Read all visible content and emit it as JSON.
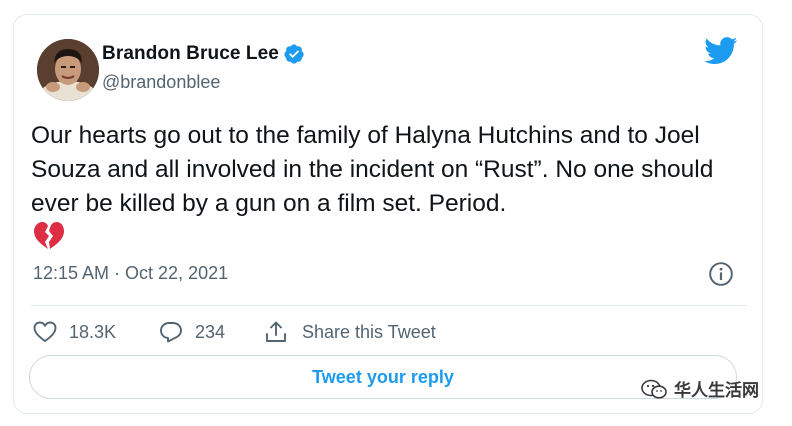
{
  "tweet": {
    "author": {
      "display_name": "Brandon Bruce Lee",
      "handle": "@brandonblee",
      "verified": true
    },
    "text": "Our hearts go out to the family of Halyna Hutchins and to Joel Souza and all involved in the incident on “Rust”. No one should ever be killed by a gun on a film set. Period.",
    "emoji": "broken-heart",
    "timestamp": "12:15 AM · Oct 22, 2021",
    "likes": "18.3K",
    "replies": "234",
    "share_label": "Share this Tweet",
    "reply_button_label": "Tweet your reply"
  },
  "watermark": {
    "text": "华人生活网"
  },
  "icons": {
    "brand": "twitter-bird-icon",
    "verified": "verified-badge-icon",
    "info": "info-icon",
    "like": "heart-outline-icon",
    "reply": "speech-bubble-icon",
    "share": "share-upload-icon"
  },
  "colors": {
    "accent": "#1d9bf0",
    "text_primary": "#0f1419",
    "text_secondary": "#536471",
    "border": "#e1e8ed",
    "emoji_red": "#dd2e44"
  }
}
